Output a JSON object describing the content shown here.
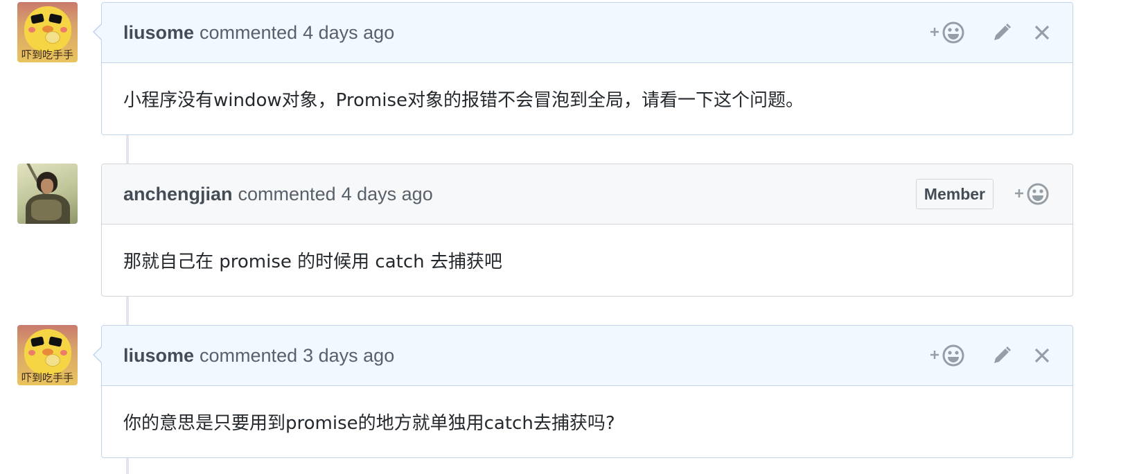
{
  "colors": {
    "self_header_bg": "#f1f8ff",
    "self_border": "#c0d3eb",
    "other_header_bg": "#f6f8fa",
    "other_border": "#d1d5da",
    "icon": "#959da5",
    "timeline": "#e1e4e8"
  },
  "icons": {
    "reaction": "add-reaction-smiley-icon",
    "edit": "pencil-icon",
    "delete": "close-x-icon"
  },
  "comments": [
    {
      "author": "liusome",
      "action": "commented",
      "time": "4 days ago",
      "avatar_caption": "吓到吃手手",
      "body": "小程序没有window对象，Promise对象的报错不会冒泡到全局，请看一下这个问题。"
    },
    {
      "author": "anchengjian",
      "action": "commented",
      "time": "4 days ago",
      "badge": "Member",
      "body": "那就自己在 promise 的时候用 catch 去捕获吧"
    },
    {
      "author": "liusome",
      "action": "commented",
      "time": "3 days ago",
      "avatar_caption": "吓到吃手手",
      "body": "你的意思是只要用到promise的地方就单独用catch去捕获吗?"
    }
  ]
}
